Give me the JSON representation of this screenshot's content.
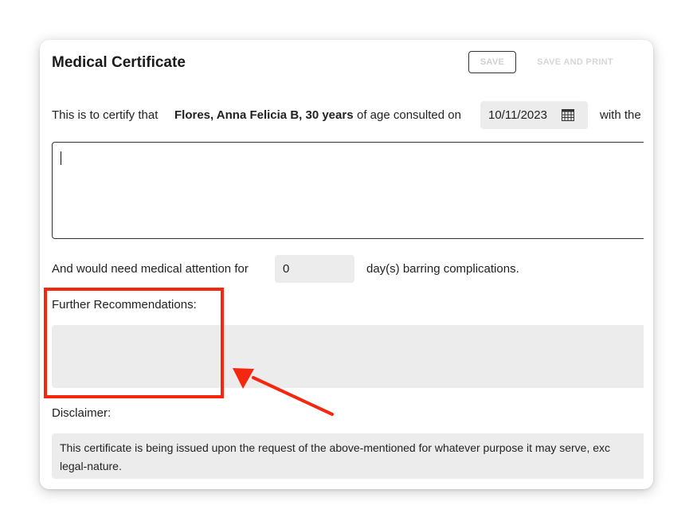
{
  "header": {
    "title": "Medical Certificate",
    "save_label": "SAVE",
    "save_print_label": "SAVE AND PRINT"
  },
  "certify": {
    "prefix": "This is to certify that",
    "patient": "Flores, Anna Felicia B, 30 years",
    "middle": "of age consulted on",
    "date_value": "10/11/2023",
    "suffix": "with the"
  },
  "attention": {
    "prefix": "And would need medical attention for",
    "days_value": "0",
    "suffix": "day(s) barring complications."
  },
  "recommendations": {
    "label": "Further Recommendations:"
  },
  "disclaimer": {
    "label": "Disclaimer:",
    "line1": "This certificate is being issued upon the request of the above-mentioned for whatever purpose it may serve, exc",
    "line2": "legal-nature."
  },
  "annotation": {
    "highlight_color": "#f5280f"
  },
  "icons": {
    "date_picker": "calendar-icon"
  }
}
